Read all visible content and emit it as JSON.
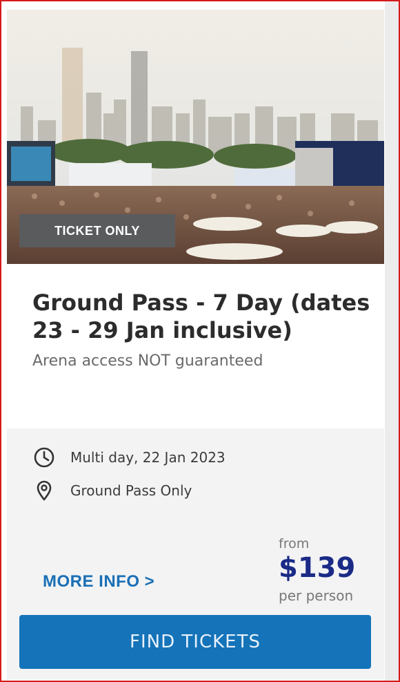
{
  "card": {
    "badge": "TICKET ONLY",
    "title": "Ground Pass - 7 Day (dates 23 - 29 Jan inclusive)",
    "subtitle": "Arena access NOT guaranteed",
    "date": {
      "icon": "clock-icon",
      "text": "Multi day, 22 Jan 2023"
    },
    "location": {
      "icon": "map-pin-icon",
      "text": "Ground Pass Only"
    },
    "more_info_label": "MORE INFO >",
    "price": {
      "from": "from",
      "amount": "$139",
      "per": "per person"
    },
    "cta_label": "FIND TICKETS"
  },
  "colors": {
    "accent_blue": "#1473b9",
    "price_navy": "#1a2a86",
    "frame_red": "#d6191b",
    "badge_gray": "#5a5b5d",
    "panel_bg": "#f3f3f4"
  }
}
